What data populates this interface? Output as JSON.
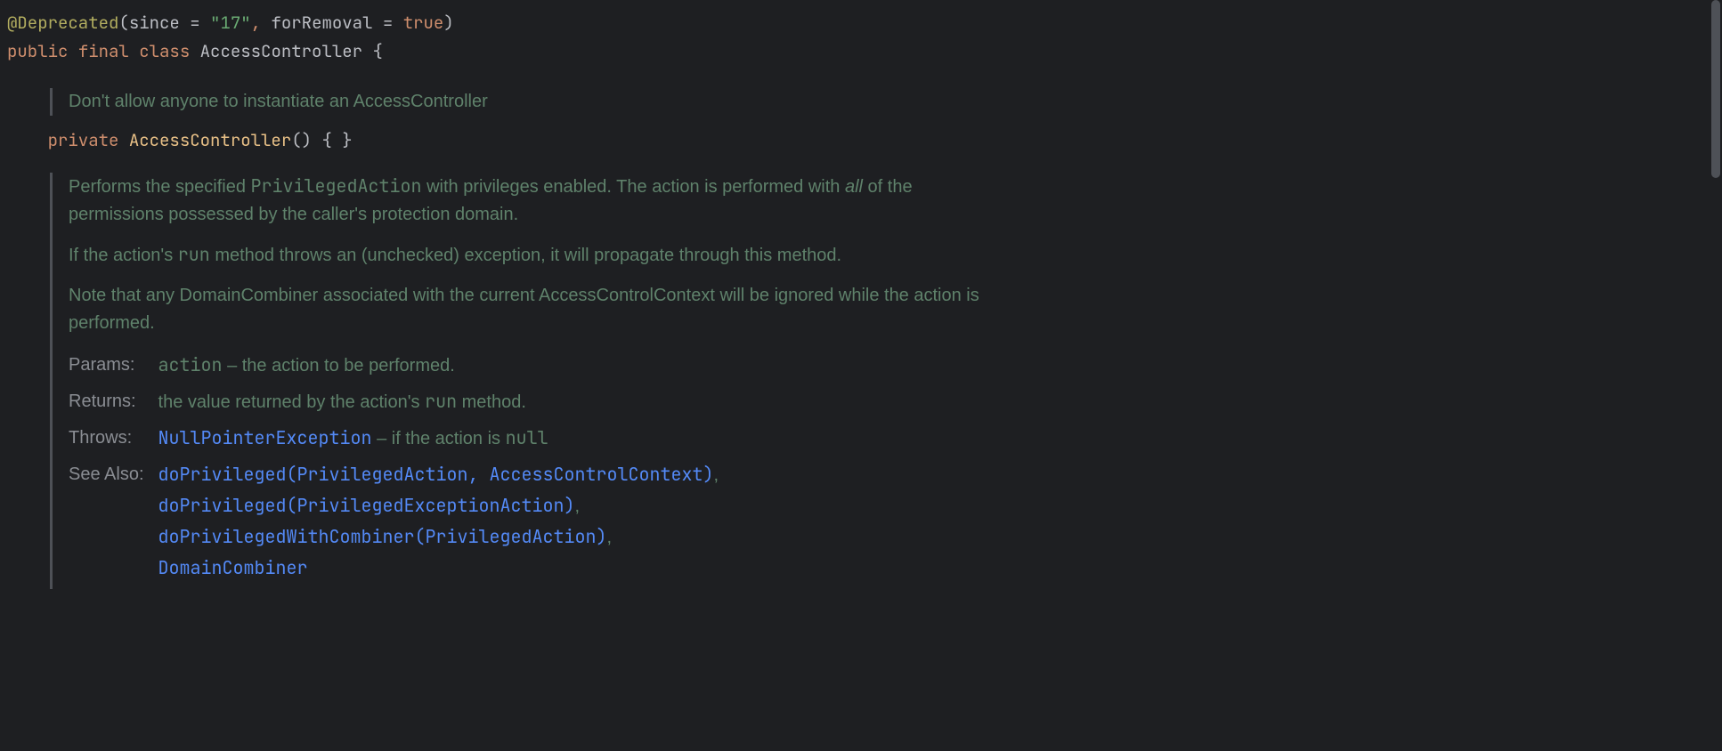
{
  "code": {
    "annotation": "@Deprecated",
    "since_attr": "since",
    "since_val": "\"17\"",
    "removal_attr": "forRemoval",
    "removal_val": "true",
    "mod_public": "public",
    "mod_final": "final",
    "kw_class": "class",
    "class_name": "AccessController",
    "mod_private": "private",
    "ctor_name": "AccessController"
  },
  "doc1": {
    "text": "Don't allow anyone to instantiate an AccessController"
  },
  "doc2": {
    "p1_a": "Performs the specified ",
    "p1_code1": "PrivilegedAction",
    "p1_b": " with privileges enabled. The action is performed with ",
    "p1_italic": "all",
    "p1_c": " of the permissions possessed by the caller's protection domain.",
    "p2_a": "If the action's ",
    "p2_code1": "run",
    "p2_b": " method throws an (unchecked) exception, it will propagate through this method.",
    "p3": "Note that any DomainCombiner associated with the current AccessControlContext will be ignored while the action is performed."
  },
  "tags": {
    "params_label": "Params:",
    "params_code": "action",
    "params_text": " – the action to be performed.",
    "returns_label": "Returns:",
    "returns_a": "the value returned by the action's ",
    "returns_code": "run",
    "returns_b": " method.",
    "throws_label": "Throws:",
    "throws_link": "NullPointerException",
    "throws_a": " – if the action is ",
    "throws_code": "null",
    "seealso_label": "See Also:",
    "see1": "doPrivileged(PrivilegedAction, AccessControlContext)",
    "see2": "doPrivileged(PrivilegedExceptionAction)",
    "see3": "doPrivilegedWithCombiner(PrivilegedAction)",
    "see4": "DomainCombiner"
  }
}
